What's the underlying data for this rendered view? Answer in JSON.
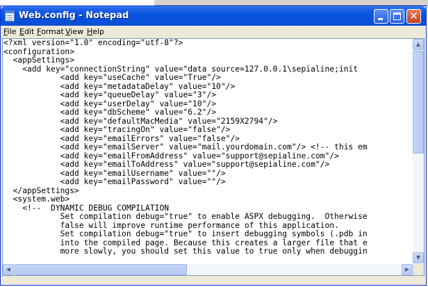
{
  "window": {
    "title": "Web.config - Notepad",
    "close_glyph": "✕"
  },
  "menu": [
    "File",
    "Edit",
    "Format",
    "View",
    "Help"
  ],
  "editor": {
    "lines": [
      "<?xml version=\"1.0\" encoding=\"utf-8\"?>",
      "<configuration>",
      "  <appSettings>",
      "    <add key=\"connectionString\" value=\"data source=127.0.0.1\\sepialine;init",
      "            <add key=\"useCache\" value=\"True\"/>",
      "            <add key=\"metadataDelay\" value=\"10\"/>",
      "            <add key=\"queueDelay\" value=\"3\"/>",
      "            <add key=\"userDelay\" value=\"10\"/>",
      "            <add key=\"dbScheme\" value=\"6.2\"/>",
      "            <add key=\"defaultMacMedia\" value=\"2159X2794\"/>",
      "            <add key=\"tracingOn\" value=\"false\"/>",
      "            <add key=\"emailErrors\" value=\"false\"/>",
      "            <add key=\"emailServer\" value=\"mail.yourdomain.com\"/> <!-- this em",
      "            <add key=\"emailFromAddress\" value=\"support@sepialine.com\"/>",
      "            <add key=\"emailToAddress\" value=\"support@sepialine.com\"/>",
      "            <add key=\"emailUsername\" value=\"\"/>",
      "            <add key=\"emailPassword\" value=\"\"/>",
      "  </appSettings>",
      "  <system.web>",
      "    <!--  DYNAMIC DEBUG COMPILATION",
      "            Set compilation debug=\"true\" to enable ASPX debugging.  Otherwise",
      "            false will improve runtime performance of this application.",
      "            Set compilation debug=\"true\" to insert debugging symbols (.pdb in",
      "            into the compiled page. Because this creates a larger file that e",
      "            more slowly, you should set this value to true only when debuggin"
    ]
  },
  "scrollbars": {
    "up_arrow": "▲",
    "down_arrow": "▼",
    "left_arrow": "◀",
    "right_arrow": "▶",
    "vertical_position": 0.0,
    "horizontal_position": 0.0
  },
  "colors": {
    "titlebar": "#0a55e1",
    "frame": "#ece9d8",
    "editor_bg": "#ffffff"
  }
}
